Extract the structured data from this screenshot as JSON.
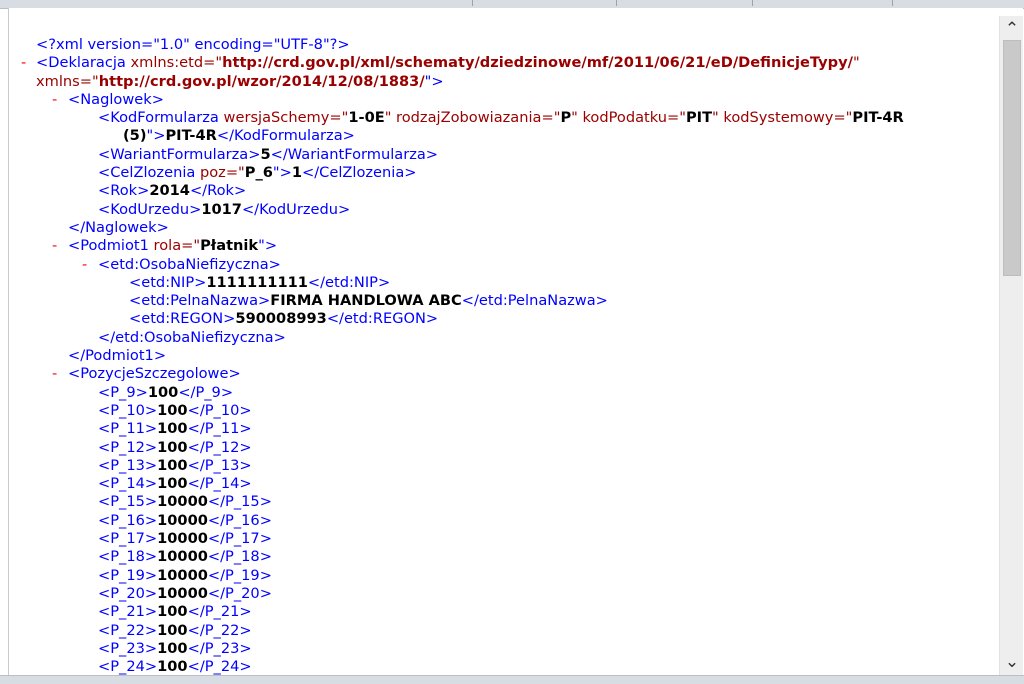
{
  "xml": {
    "declaration": "<?xml version=\"1.0\" encoding=\"UTF-8\"?>",
    "collapse_marker": "-",
    "root_open_name": "<Deklaracja",
    "root_attr1_name": " xmlns:etd=\"",
    "root_attr1_value": "http://crd.gov.pl/xml/schematy/dziedzinowe/mf/2011/06/21/eD/DefinicjeTypy/",
    "root_attr1_close": "\"",
    "root_attr2_name": "xmlns=\"",
    "root_attr2_value": "http://crd.gov.pl/wzor/2014/12/08/1883/",
    "root_attr2_close": "\">",
    "naglowek_open": "<Naglowek>",
    "kodformularza": {
      "open": "<KodFormularza",
      "a1": " wersjaSchemy=\"",
      "v1": "1-0E",
      "a2": "\" rodzajZobowiazania=\"",
      "v2": "P",
      "a3": "\" kodPodatku=\"",
      "v3": "PIT",
      "a4": "\" kodSystemowy=\"",
      "v4": "PIT-4R",
      "v4_cont": "(5)",
      "gt": "\">",
      "value": "PIT-4R",
      "close": "</KodFormularza>"
    },
    "wariant": {
      "open": "<WariantFormularza>",
      "value": "5",
      "close": "</WariantFormularza>"
    },
    "celzlozenia": {
      "open": "<CelZlozenia",
      "a1": " poz=\"",
      "v1": "P_6",
      "gt": "\">",
      "value": "1",
      "close": "</CelZlozenia>"
    },
    "rok": {
      "open": "<Rok>",
      "value": "2014",
      "close": "</Rok>"
    },
    "kodurzedu": {
      "open": "<KodUrzedu>",
      "value": "1017",
      "close": "</KodUrzedu>"
    },
    "naglowek_close": "</Naglowek>",
    "podmiot": {
      "open": "<Podmiot1",
      "a1": " rola=\"",
      "v1": "Płatnik",
      "gt": "\">",
      "close": "</Podmiot1>"
    },
    "osoba_open": "<etd:OsobaNiefizyczna>",
    "nip": {
      "open": "<etd:NIP>",
      "value": "1111111111",
      "close": "</etd:NIP>"
    },
    "pelnanazwa": {
      "open": "<etd:PelnaNazwa>",
      "value": "FIRMA HANDLOWA ABC",
      "close": "</etd:PelnaNazwa>"
    },
    "regon": {
      "open": "<etd:REGON>",
      "value": "590008993",
      "close": "</etd:REGON>"
    },
    "osoba_close": "</etd:OsobaNiefizyczna>",
    "pozycje_open": "<PozycjeSzczegolowe>",
    "positions": [
      {
        "open": "<P_9>",
        "value": "100",
        "close": "</P_9>"
      },
      {
        "open": "<P_10>",
        "value": "100",
        "close": "</P_10>"
      },
      {
        "open": "<P_11>",
        "value": "100",
        "close": "</P_11>"
      },
      {
        "open": "<P_12>",
        "value": "100",
        "close": "</P_12>"
      },
      {
        "open": "<P_13>",
        "value": "100",
        "close": "</P_13>"
      },
      {
        "open": "<P_14>",
        "value": "100",
        "close": "</P_14>"
      },
      {
        "open": "<P_15>",
        "value": "10000",
        "close": "</P_15>"
      },
      {
        "open": "<P_16>",
        "value": "10000",
        "close": "</P_16>"
      },
      {
        "open": "<P_17>",
        "value": "10000",
        "close": "</P_17>"
      },
      {
        "open": "<P_18>",
        "value": "10000",
        "close": "</P_18>"
      },
      {
        "open": "<P_19>",
        "value": "10000",
        "close": "</P_19>"
      },
      {
        "open": "<P_20>",
        "value": "10000",
        "close": "</P_20>"
      },
      {
        "open": "<P_21>",
        "value": "100",
        "close": "</P_21>"
      },
      {
        "open": "<P_22>",
        "value": "100",
        "close": "</P_22>"
      },
      {
        "open": "<P_23>",
        "value": "100",
        "close": "</P_23>"
      },
      {
        "open": "<P_24>",
        "value": "100",
        "close": "</P_24>"
      }
    ]
  },
  "scrollbar": {
    "up_icon": "chevron-up-icon",
    "down_icon": "chevron-down-icon"
  }
}
